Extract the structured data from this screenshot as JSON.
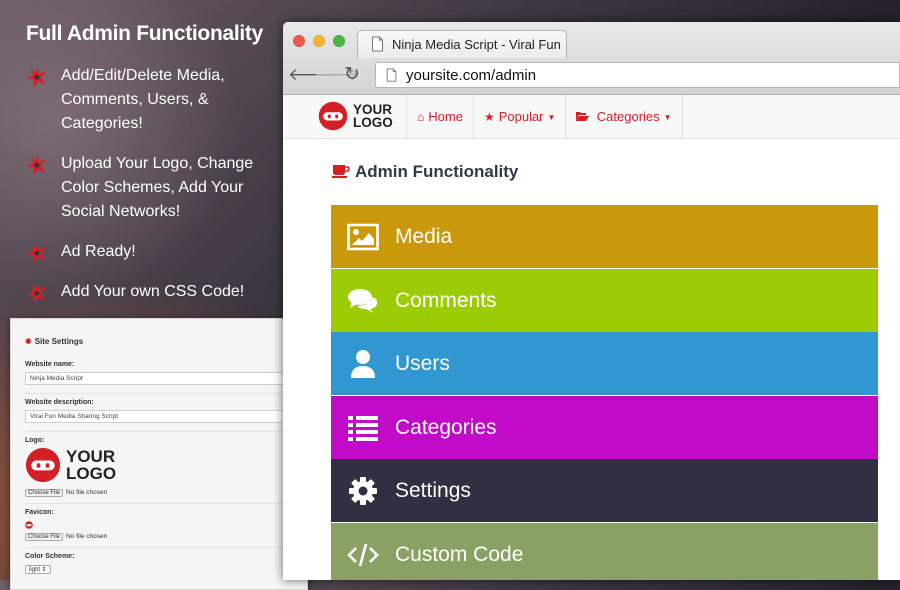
{
  "promo": {
    "title": "Full Admin Functionality",
    "features": [
      "Add/Edit/Delete Media, Comments, Users, & Categories!",
      "Upload Your Logo, Change Color Schemes, Add Your Social Networks!",
      "Ad Ready!",
      "Add Your own CSS Code!"
    ],
    "bullet_icon": "ninja-star-icon",
    "bullet_color": "#d32027"
  },
  "settings_panel": {
    "title": "Site Settings",
    "title_icon": "gear-icon",
    "website_name_label": "Website name:",
    "website_name_value": "Ninja Media Script",
    "website_description_label": "Website description:",
    "website_description_value": "Viral Fun Media Sharing Script",
    "logo_label": "Logo:",
    "logo_text_line1": "YOUR",
    "logo_text_line2": "LOGO",
    "favicon_label": "Favicon:",
    "choose_file_label": "Choose File",
    "no_file_text": "No file chosen",
    "color_scheme_label": "Color Scheme:",
    "color_scheme_value": "light"
  },
  "browser": {
    "tab_title": "Ninja Media Script - Viral Fun",
    "url": "yoursite.com/admin"
  },
  "site": {
    "logo_text_line1": "YOUR",
    "logo_text_line2": "LOGO",
    "nav": [
      {
        "label": "Home",
        "icon": "home-icon"
      },
      {
        "label": "Popular",
        "icon": "star-icon"
      },
      {
        "label": "Categories",
        "icon": "folder-open-icon"
      }
    ],
    "accent_color": "#d32027"
  },
  "admin": {
    "heading": "Admin Functionality",
    "heading_icon": "coffee-cup-icon",
    "items": [
      {
        "label": "Media",
        "icon": "image-icon",
        "color": "#c9990b"
      },
      {
        "label": "Comments",
        "icon": "comments-icon",
        "color": "#9ccc04"
      },
      {
        "label": "Users",
        "icon": "user-icon",
        "color": "#3097d1"
      },
      {
        "label": "Categories",
        "icon": "list-icon",
        "color": "#c20bc9"
      },
      {
        "label": "Settings",
        "icon": "gear-icon",
        "color": "#2f3142"
      },
      {
        "label": "Custom Code",
        "icon": "code-icon",
        "color": "#8aa164"
      }
    ]
  }
}
